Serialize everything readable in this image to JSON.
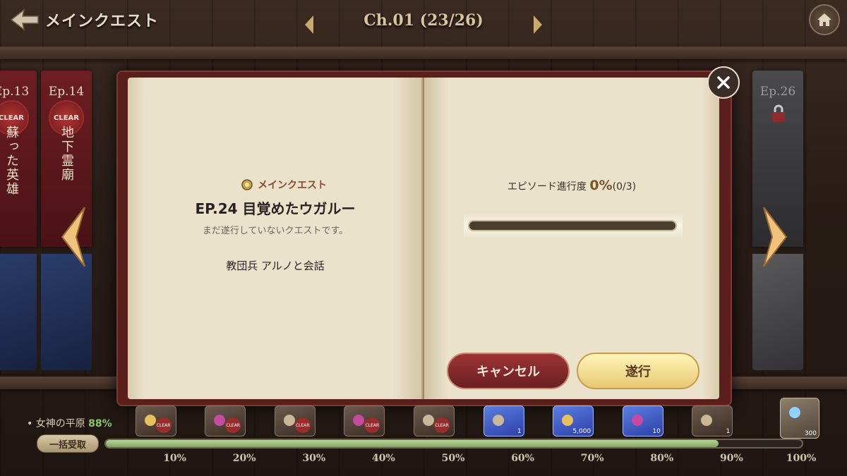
{
  "header": {
    "back_label": "メインクエスト",
    "chapter": "Ch.01 (23/26)"
  },
  "shelf_books": [
    {
      "ep": "Ep.13",
      "status": "CLEAR",
      "title": "蘇った英雄"
    },
    {
      "ep": "Ep.14",
      "status": "CLEAR",
      "title": "地下霊廟"
    },
    {
      "ep": "Ep.26",
      "status": "locked"
    }
  ],
  "dialog": {
    "tag": "メインクエスト",
    "title": "EP.24 目覚めたウガルー",
    "description": "まだ遂行していないクエストです。",
    "objective": "教団兵 アルノと会話",
    "progress_label": "エピソード進行度",
    "progress_pct": "0%",
    "progress_count": "(0/3)",
    "progress_value": 0,
    "cancel_label": "キャンセル",
    "go_label": "遂行"
  },
  "footer": {
    "region_label": "女神の平原",
    "region_pct": "88%",
    "claim_label": "一括受取",
    "progress_value": 0.88,
    "ticks": [
      "10%",
      "20%",
      "30%",
      "40%",
      "50%",
      "60%",
      "70%",
      "80%",
      "90%",
      "100%"
    ],
    "rewards": [
      {
        "type": "gold",
        "status": "CLEAR"
      },
      {
        "type": "potion",
        "status": "CLEAR"
      },
      {
        "type": "coin",
        "status": "CLEAR"
      },
      {
        "type": "potion",
        "status": "CLEAR"
      },
      {
        "type": "item",
        "status": "CLEAR"
      },
      {
        "type": "crystal",
        "count": "1"
      },
      {
        "type": "gold",
        "count": "5,000"
      },
      {
        "type": "potion",
        "count": "10"
      },
      {
        "type": "item",
        "count": "1"
      },
      {
        "type": "gem",
        "count": "300"
      }
    ]
  }
}
